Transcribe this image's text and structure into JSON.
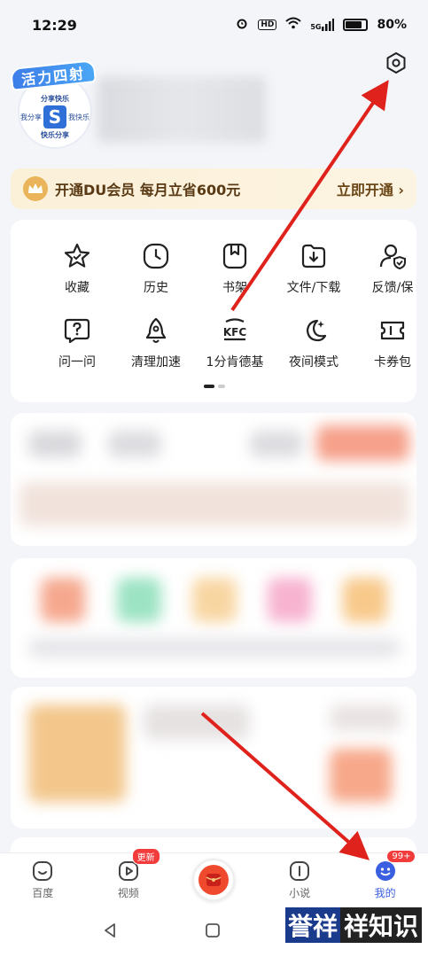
{
  "status_bar": {
    "time": "12:29",
    "hd": "HD",
    "signal": "5G",
    "battery_text": "80%",
    "battery_level": 0.8
  },
  "profile": {
    "badge": "活力四射",
    "avatar_line1": "分享快乐",
    "avatar_line2": "我分享",
    "avatar_line3": "我快乐",
    "avatar_logo": "S",
    "avatar_line4": "快乐分享"
  },
  "vip": {
    "text": "开通DU会员 每月立省600元",
    "action": "立即开通 ›"
  },
  "tools": {
    "row1": [
      {
        "label": "收藏",
        "icon": "star-icon"
      },
      {
        "label": "历史",
        "icon": "clock-icon"
      },
      {
        "label": "书架",
        "icon": "bookmark-icon"
      },
      {
        "label": "文件/下载",
        "icon": "download-icon"
      },
      {
        "label": "反馈/保",
        "icon": "feedback-icon"
      }
    ],
    "row2": [
      {
        "label": "问一问",
        "icon": "question-icon"
      },
      {
        "label": "清理加速",
        "icon": "rocket-icon"
      },
      {
        "label": "1分肯德基",
        "icon": "kfc-icon"
      },
      {
        "label": "夜间模式",
        "icon": "moon-icon"
      },
      {
        "label": "卡券包",
        "icon": "ticket-icon"
      }
    ]
  },
  "bottom_nav": [
    {
      "label": "百度",
      "icon": "baidu-icon"
    },
    {
      "label": "视频",
      "icon": "video-icon",
      "badge": "更新"
    },
    {
      "label": "",
      "icon": "red-envelope-icon"
    },
    {
      "label": "小说",
      "icon": "novel-icon"
    },
    {
      "label": "我的",
      "icon": "profile-icon",
      "badge": "99+"
    }
  ],
  "watermark": {
    "part1": "誉祥",
    "part2": "祥知识"
  },
  "colors": {
    "accent": "#3a5fe0",
    "arrow": "#e0221c",
    "vip_bg": "#fbf0d8",
    "badge": "#f23b3b"
  }
}
